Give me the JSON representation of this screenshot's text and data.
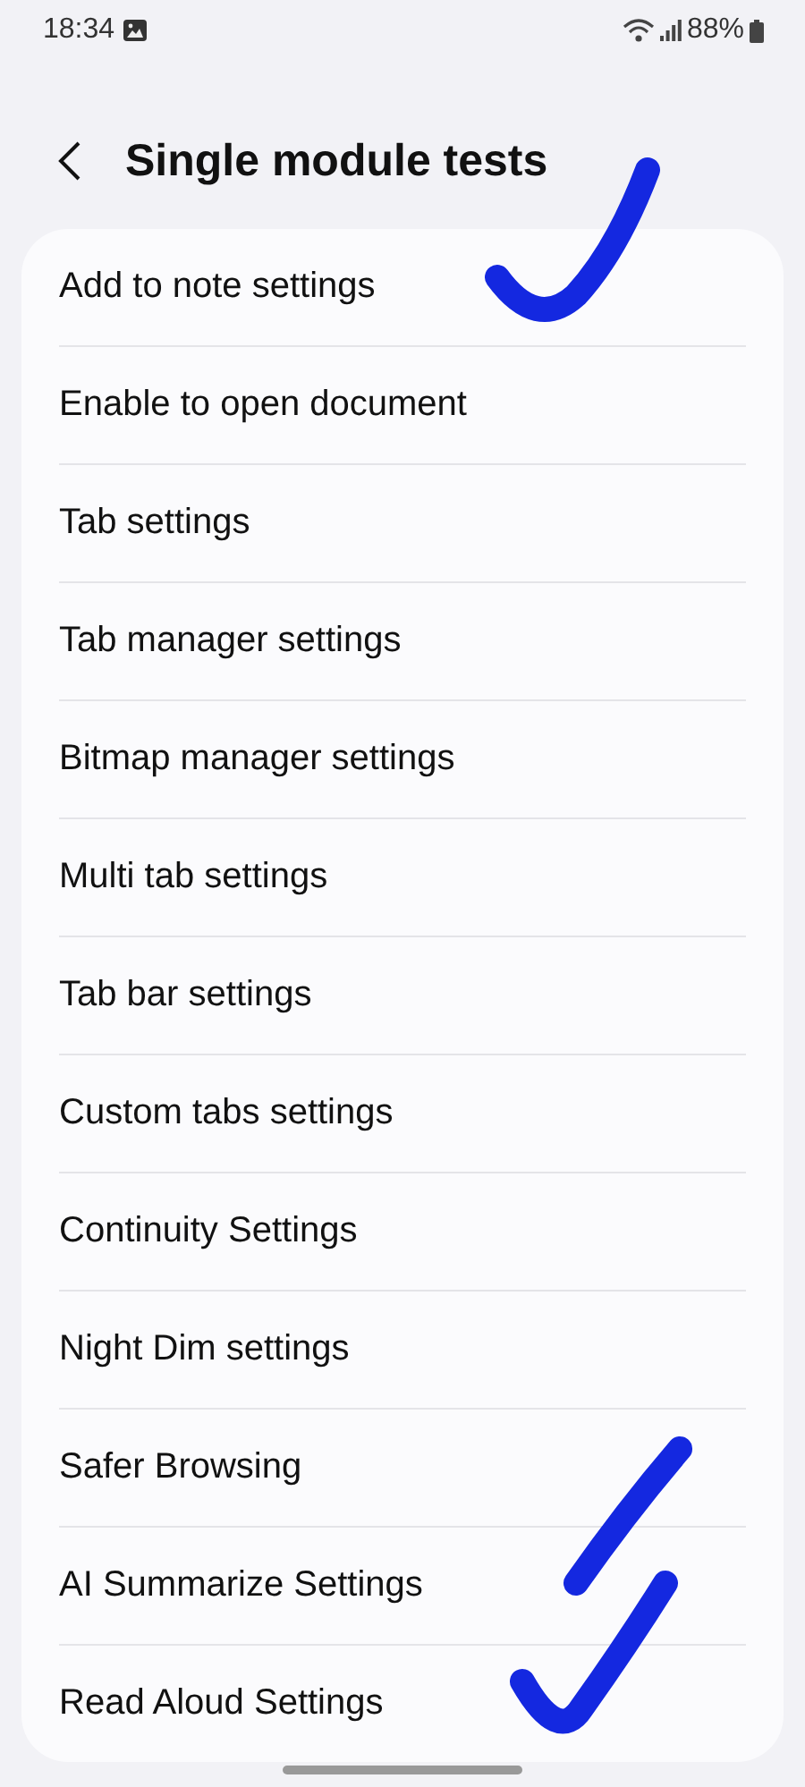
{
  "status_bar": {
    "time": "18:34",
    "battery": "88%"
  },
  "header": {
    "title": "Single module tests"
  },
  "items": [
    {
      "label": "Add to note settings"
    },
    {
      "label": "Enable to open document"
    },
    {
      "label": "Tab settings"
    },
    {
      "label": "Tab manager settings"
    },
    {
      "label": "Bitmap manager settings"
    },
    {
      "label": "Multi tab settings"
    },
    {
      "label": "Tab bar settings"
    },
    {
      "label": "Custom tabs settings"
    },
    {
      "label": "Continuity Settings"
    },
    {
      "label": "Night Dim settings"
    },
    {
      "label": "Safer Browsing"
    },
    {
      "label": "AI Summarize Settings"
    },
    {
      "label": "Read Aloud Settings"
    }
  ]
}
